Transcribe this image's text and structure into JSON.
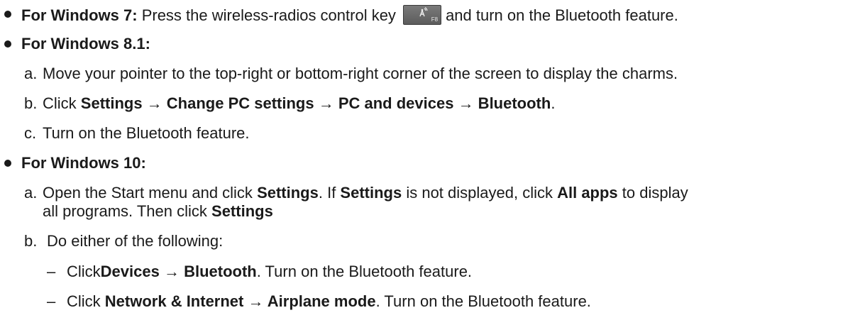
{
  "win7": {
    "heading": "For Windows 7:",
    "text_before_key": " Press the wireless-radios control key",
    "key_label": "F8",
    "text_after_key": "and turn on the Bluetooth feature."
  },
  "win81": {
    "heading": "For Windows 8.1:",
    "step_a": {
      "marker": "a.",
      "text": "Move your pointer to the top-right or bottom-right corner of the screen to display the charms."
    },
    "step_b": {
      "marker": "b.",
      "prefix": "Click ",
      "path": "Settings → Change PC settings → PC and devices → Bluetooth",
      "suffix": "."
    },
    "step_c": {
      "marker": "c.",
      "text": "Turn on the Bluetooth feature."
    }
  },
  "win10": {
    "heading": "For Windows 10:",
    "step_a": {
      "marker": "a.",
      "t1": "Open the Start menu and click ",
      "b1": "Settings",
      "t2": ". If ",
      "b2": "Settings",
      "t3": " is not displayed, click ",
      "b3": "All apps",
      "t4": " to display",
      "t5": "all programs. Then click ",
      "b4": "Settings"
    },
    "step_b": {
      "marker": "b.",
      "text": "Do either of the following:"
    },
    "options": [
      {
        "dash": "–",
        "prefix": "Click",
        "path": "Devices → Bluetooth",
        "suffix": ". Turn on the Bluetooth feature."
      },
      {
        "dash": "–",
        "prefix": "Click ",
        "path": "Network & Internet → Airplane mode",
        "suffix": ". Turn on the Bluetooth feature."
      }
    ]
  }
}
